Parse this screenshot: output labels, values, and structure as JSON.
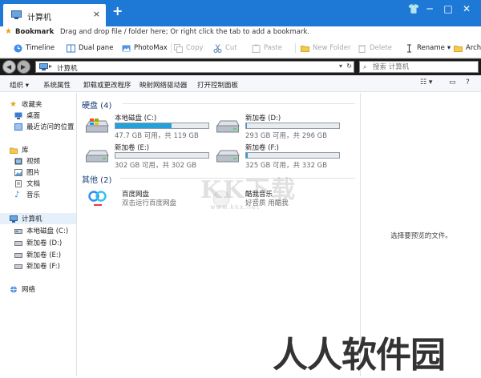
{
  "tab": {
    "title": "计算机",
    "close": "×",
    "add": "+"
  },
  "window_controls": {
    "shirt": "👕",
    "minimize": "─",
    "maximize": "□",
    "close": "✕"
  },
  "bookmark_bar": {
    "title": "Bookmark",
    "hint": "Drag and drop file / folder here; Or right click the tab to add a bookmark."
  },
  "toolbar": {
    "timeline": "Timeline",
    "dual_pane": "Dual pane",
    "photomax": "PhotoMax",
    "copy": "Copy",
    "cut": "Cut",
    "paste": "Paste",
    "new_folder": "New Folder",
    "delete": "Delete",
    "rename": "Rename",
    "archive": "Archi"
  },
  "address": {
    "path": "计算机",
    "search_placeholder": "搜索 计算机"
  },
  "command_bar": {
    "organize": "组织 ▾",
    "system_properties": "系统属性",
    "uninstall": "卸载或更改程序",
    "map_drive": "映射网络驱动器",
    "control_panel": "打开控制面板"
  },
  "nav": {
    "favorites": "收藏夹",
    "desktop": "桌面",
    "recent": "最近访问的位置",
    "libraries": "库",
    "videos": "视频",
    "pictures": "图片",
    "documents": "文档",
    "music": "音乐",
    "computer": "计算机",
    "local_c": "本地磁盘 (C:)",
    "vol_d": "新加卷 (D:)",
    "vol_e": "新加卷 (E:)",
    "vol_f": "新加卷 (F:)",
    "network": "网络"
  },
  "groups": {
    "hard_disks": "硬盘 (4)",
    "other": "其他 (2)"
  },
  "drives": [
    {
      "name": "本地磁盘 (C:)",
      "space": "47.7 GB 可用，共 119 GB",
      "used_fraction": 0.6
    },
    {
      "name": "新加卷 (D:)",
      "space": "293 GB 可用，共 296 GB",
      "used_fraction": 0.01
    },
    {
      "name": "新加卷 (E:)",
      "space": "302 GB 可用，共 302 GB",
      "used_fraction": 0.0
    },
    {
      "name": "新加卷 (F:)",
      "space": "325 GB 可用，共 332 GB",
      "used_fraction": 0.02
    }
  ],
  "apps": [
    {
      "name": "百度网盘",
      "desc": "双击运行百度网盘"
    },
    {
      "name": "酷我音乐",
      "desc": "好音质 用酷我"
    }
  ],
  "preview": {
    "text": "选择要预览的文件。"
  },
  "watermarks": {
    "kk": "KK下载",
    "url": "www.kkx.net",
    "rr": "人人软件园"
  },
  "colors": {
    "title_bar": "#1d78d6",
    "drive_fill": "#26a0da",
    "group_heading": "#1a3e78"
  }
}
